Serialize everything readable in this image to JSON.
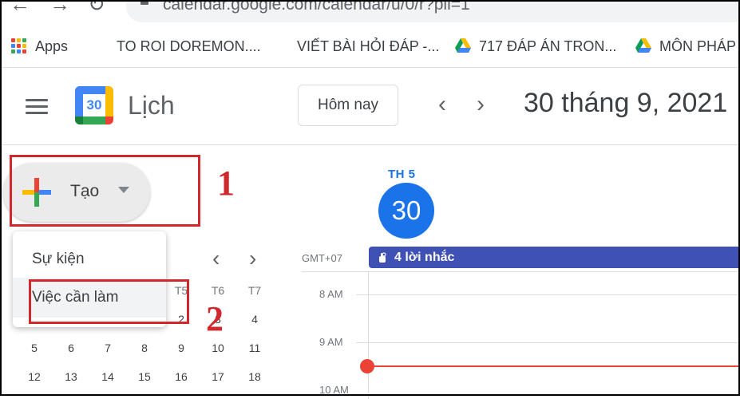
{
  "browser": {
    "url": "calendar.google.com/calendar/u/0/r?pli=1",
    "bookmarks": [
      {
        "label": "Apps",
        "icon": "apps-grid-icon"
      },
      {
        "label": "TO ROI DOREMON....",
        "icon": "globe-icon"
      },
      {
        "label": "VIẾT BÀI HỎI ĐÁP -...",
        "icon": "google-sheets-icon"
      },
      {
        "label": "717 ĐÁP ÁN TRON...",
        "icon": "google-drive-icon"
      },
      {
        "label": "MÔN PHÁP",
        "icon": "google-drive-icon"
      }
    ]
  },
  "header": {
    "app_name": "Lịch",
    "logo_number": "30",
    "today_label": "Hôm nay",
    "date_title": "30 tháng 9, 2021"
  },
  "create": {
    "label": "Tạo",
    "menu": [
      "Sự kiện",
      "Việc cần làm"
    ]
  },
  "annotations": {
    "first": "1",
    "second": "2"
  },
  "mini_calendar": {
    "visible_weekdays": [
      "T5",
      "T6",
      "T7"
    ],
    "rows": [
      [
        "",
        "",
        "",
        "",
        "2",
        "3",
        "4"
      ],
      [
        "5",
        "6",
        "7",
        "8",
        "9",
        "10",
        "11"
      ],
      [
        "12",
        "13",
        "14",
        "15",
        "16",
        "17",
        "18"
      ]
    ]
  },
  "day_view": {
    "weekday": "TH 5",
    "day_number": "30",
    "timezone": "GMT+07",
    "reminder": "4 lời nhắc",
    "hours": [
      "8 AM",
      "9 AM",
      "10 AM"
    ]
  },
  "colors": {
    "accent": "#1a73e8",
    "reminder_bg": "#3f51b5",
    "now_line": "#ea4335",
    "annotation": "#d1282e"
  }
}
